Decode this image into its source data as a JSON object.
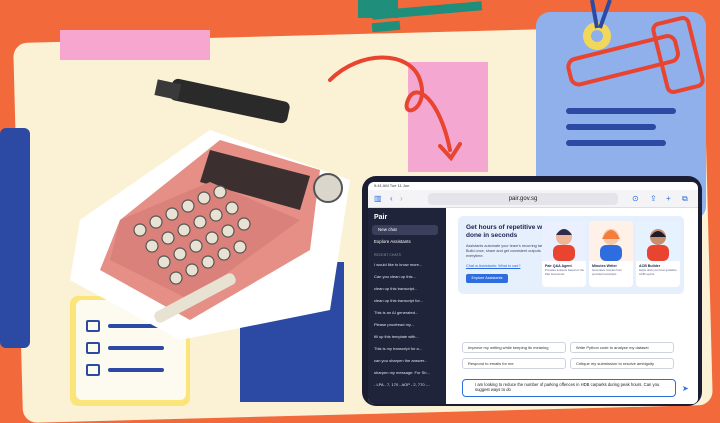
{
  "browser": {
    "status_time": "9:41 AM",
    "status_date": "Tue 11 Jun",
    "url": "pair.gov.sg"
  },
  "sidebar": {
    "logo": "Pair",
    "new_chat": "New chat",
    "explore": "Explore Assistants",
    "recent_label": "RECENT CHATS",
    "history": [
      "I would like to know more...",
      "Can you clean up this...",
      "clean up this transcript...",
      "clean up this transcript for...",
      "This is an AI generated...",
      "Please proofread my...",
      "fill up this template with...",
      "This is my transcript for a...",
      "can you sharpen the answer...",
      "sharpen my message: For Sh...",
      "- LPA - 7, 170 - AOP - 2, 770 -..."
    ]
  },
  "banner": {
    "headline": "Get hours of repetitive work done in seconds",
    "subtext": "Assistants automate your team's recurring tasks. Build once, share and get consistent outputs everytime.",
    "link": "Chat w Assistants: What to use?",
    "button": "Explore Assistants",
    "cards": [
      {
        "title": "Pair Q&A Agent",
        "desc": "Provides answers based on the Pair documents"
      },
      {
        "title": "Minutes Writer",
        "desc": "Generates minutes from provided transcripts"
      },
      {
        "title": "ACB Builder",
        "desc": "Helps draft your best guideline ACB reports"
      }
    ]
  },
  "suggestions": [
    "Improve my writing while keeping its meaning",
    "Write Python code to analyse my dataset",
    "Respond to emails for me",
    "Critique my submission to resolve ambiguity"
  ],
  "input": {
    "value": "I am looking to reduce the number of parking offences in HDB carparks during peak hours. Can you suggest ways to do"
  },
  "colors": {
    "background": "#f26a3b",
    "accent_blue": "#2d6de0",
    "sidebar": "#20243a"
  }
}
